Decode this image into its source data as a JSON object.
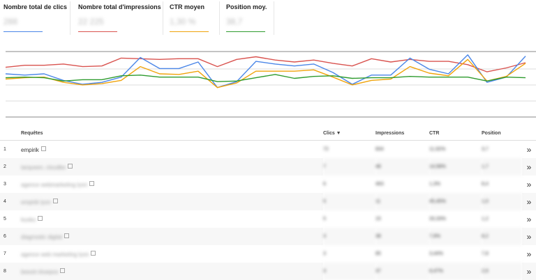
{
  "metrics": [
    {
      "label": "Nombre total de clics",
      "value": "288",
      "color": "#4a86e8"
    },
    {
      "label": "Nombre total d'impressions",
      "value": "22 225",
      "color": "#d9534f"
    },
    {
      "label": "CTR moyen",
      "value": "1,30 %",
      "color": "#f0a30a"
    },
    {
      "label": "Position moy.",
      "value": "38,7",
      "color": "#2e9b2e"
    }
  ],
  "table": {
    "headers": {
      "query": "Requêtes",
      "clicks": "Clics ▼",
      "impressions": "Impressions",
      "ctr": "CTR",
      "position": "Position"
    },
    "rows": [
      {
        "num": "1",
        "query": "empirik",
        "clicks": "72",
        "impressions": "604",
        "ctr": "11,92%",
        "position": "3,7"
      },
      {
        "num": "2",
        "query": "tarqueen, cloudbe",
        "clicks": "7",
        "impressions": "48",
        "ctr": "14,58%",
        "position": "1,7"
      },
      {
        "num": "3",
        "query": "agence webmarketing lyon",
        "clicks": "6",
        "impressions": "463",
        "ctr": "1,3%",
        "position": "8,4"
      },
      {
        "num": "4",
        "query": "empirik lyon",
        "clicks": "5",
        "impressions": "11",
        "ctr": "45,45%",
        "position": "1,0"
      },
      {
        "num": "5",
        "query": "kuoku",
        "clicks": "5",
        "impressions": "15",
        "ctr": "33,33%",
        "position": "1,2"
      },
      {
        "num": "6",
        "query": "diagnostic digital",
        "clicks": "3",
        "impressions": "38",
        "ctr": "7,9%",
        "position": "8,2"
      },
      {
        "num": "7",
        "query": "agence web marketing lyon",
        "clicks": "3",
        "impressions": "85",
        "ctr": "3,44%",
        "position": "7,8"
      },
      {
        "num": "8",
        "query": "besoin kluepos",
        "clicks": "3",
        "impressions": "37",
        "ctr": "8,47%",
        "position": "2,6"
      }
    ]
  },
  "chart_data": {
    "type": "line",
    "grid": true,
    "series": [
      {
        "color": "#d9534f",
        "values": [
          76,
          79,
          79,
          81,
          77,
          78,
          90,
          89,
          88,
          89,
          89,
          77,
          88,
          92,
          87,
          84,
          87,
          82,
          78,
          89,
          84,
          88,
          85,
          85,
          80,
          69,
          75,
          83
        ]
      },
      {
        "color": "#4a86e8",
        "values": [
          66,
          64,
          66,
          56,
          50,
          53,
          61,
          91,
          74,
          74,
          84,
          45,
          54,
          85,
          81,
          78,
          81,
          68,
          50,
          64,
          64,
          90,
          73,
          66,
          95,
          53,
          61,
          93
        ]
      },
      {
        "color": "#f0a30a",
        "values": [
          58,
          60,
          61,
          53,
          49,
          51,
          56,
          77,
          66,
          65,
          70,
          45,
          52,
          70,
          70,
          70,
          72,
          61,
          49,
          56,
          58,
          77,
          67,
          63,
          88,
          55,
          62,
          82
        ]
      },
      {
        "color": "#2e9b2e",
        "values": [
          60,
          61,
          60,
          55,
          57,
          57,
          63,
          64,
          61,
          61,
          61,
          54,
          55,
          60,
          65,
          59,
          62,
          63,
          59,
          60,
          60,
          62,
          61,
          61,
          61,
          55,
          61,
          60
        ]
      }
    ]
  }
}
